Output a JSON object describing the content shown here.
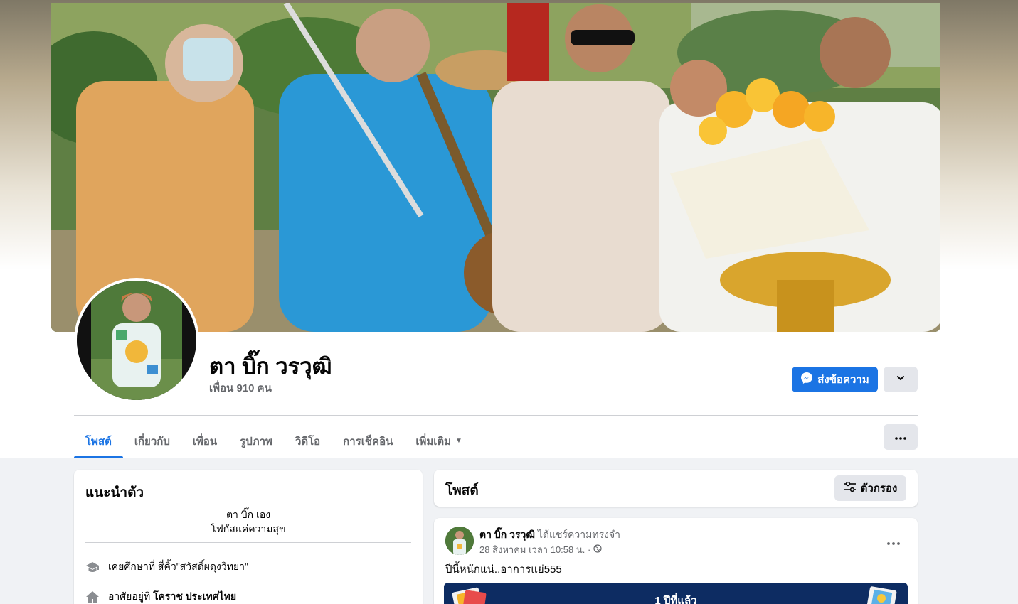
{
  "profile": {
    "name": "ตา บิ๊ก วรวุฒิ",
    "friends": "เพื่อน 910 คน"
  },
  "actions": {
    "message_label": "ส่งข้อความ"
  },
  "tabs": [
    {
      "label": "โพสต์"
    },
    {
      "label": "เกี่ยวกับ"
    },
    {
      "label": "เพื่อน"
    },
    {
      "label": "รูปภาพ"
    },
    {
      "label": "วิดีโอ"
    },
    {
      "label": "การเช็คอิน"
    },
    {
      "label": "เพิ่มเติม"
    }
  ],
  "intro": {
    "title": "แนะนำตัว",
    "bio_line1": "ตา บิ๊ก เอง",
    "bio_line2": "โฟกัสแค่ความสุข",
    "education": "เคยศึกษาที่ สี่คิ้ว\"สวัสดิ์ผดุงวิทยา\"",
    "lives_prefix": "อาศัยอยู่ที่ ",
    "lives_place": "โคราช ประเทศไทย"
  },
  "posts": {
    "title": "โพสต์",
    "filter_label": "ตัวกรอง",
    "items": [
      {
        "author": "ตา บิ๊ก วรวุฒิ",
        "action": " ได้แชร์ความทรงจำ",
        "time": "28 สิงหาคม เวลา 10:58 น. ·",
        "text": "ปีนี้หนักแน่..อาการแย่555",
        "memory": "1 ปีที่แล้ว"
      }
    ]
  },
  "colors": {
    "accent": "#1b74e4",
    "page_bg": "#f0f2f5",
    "memory_bg": "#0d2c62"
  }
}
